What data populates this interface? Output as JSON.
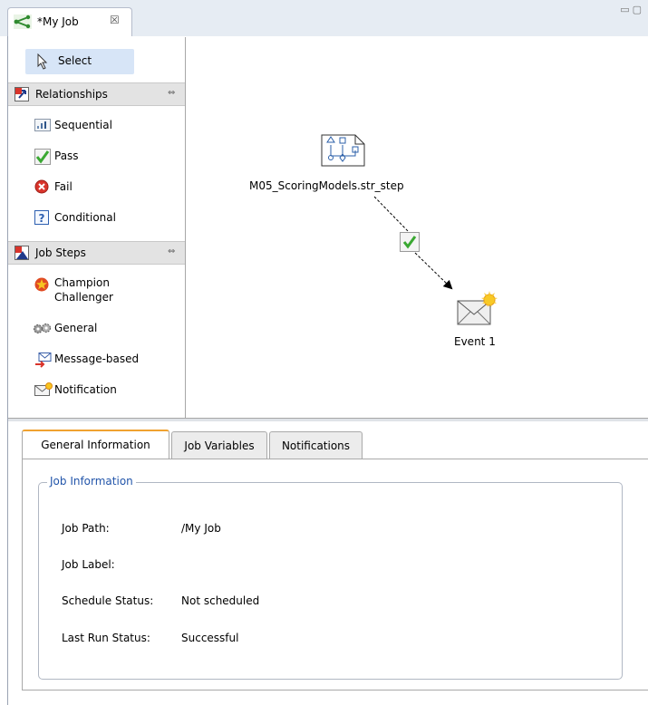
{
  "editor_tab": {
    "title": "*My Job",
    "icon": "job-diagram-icon",
    "close_glyph": "☒"
  },
  "window_controls": {
    "minimize_glyph": "▭",
    "maximize_glyph": "▢"
  },
  "palette": {
    "select_label": "Select",
    "drawers": [
      {
        "label": "Relationships",
        "icon": "relationships-icon",
        "items": [
          {
            "label": "Sequential",
            "icon": "sequential-icon"
          },
          {
            "label": "Pass",
            "icon": "pass-check-icon"
          },
          {
            "label": "Fail",
            "icon": "fail-x-icon"
          },
          {
            "label": "Conditional",
            "icon": "conditional-question-icon"
          }
        ]
      },
      {
        "label": "Job Steps",
        "icon": "job-steps-icon",
        "items": [
          {
            "label": "Champion",
            "label_line2": "Challenger",
            "icon": "champion-star-icon"
          },
          {
            "label": "General",
            "icon": "general-gears-icon"
          },
          {
            "label": "Message-based",
            "icon": "message-envelope-icon"
          },
          {
            "label": "Notification",
            "icon": "notification-envelope-icon"
          }
        ]
      }
    ],
    "collapse_glyph": "⇔"
  },
  "canvas": {
    "nodes": [
      {
        "label": "M05_ScoringModels.str_step",
        "icon": "strategy-step-document-icon"
      },
      {
        "label": "Event 1",
        "icon": "event-envelope-icon"
      }
    ],
    "connector_icon": "pass-check-icon"
  },
  "properties": {
    "tabs": [
      "General Information",
      "Job Variables",
      "Notifications"
    ],
    "active_tab": "General Information",
    "group_title": "Job Information",
    "fields": [
      {
        "label": "Job Path:",
        "value": "/My Job"
      },
      {
        "label": "Job Label:",
        "value": ""
      },
      {
        "label": "Schedule Status:",
        "value": "Not scheduled"
      },
      {
        "label": "Last Run Status:",
        "value": "Successful"
      }
    ]
  },
  "colors": {
    "accent_tab": "#f0a230",
    "selection": "#d7e5f7",
    "group_title": "#2255aa",
    "pass_green": "#3aa832",
    "fail_red": "#d9342b"
  }
}
